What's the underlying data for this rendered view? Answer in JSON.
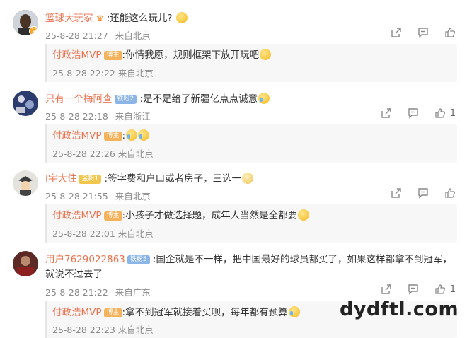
{
  "colors": {
    "username": "#eb7350",
    "meta": "#8a8a8a",
    "reply_bg": "#f7f7f7",
    "blogger_badge": "#f3b25c"
  },
  "comments": [
    {
      "user": "篮球大玩家",
      "text": ":还能这么玩儿?",
      "emoji": "surprised-emoji",
      "date": "25-8-28 21:27",
      "location": "来自北京",
      "like_count": "",
      "reply": {
        "user": "付政浩MVP",
        "badge": "博主",
        "text": ":你情我愿，规则框架下放开玩吧",
        "emoji": "laugh-emoji",
        "date": "25-8-28 22:22",
        "location": "来自北京"
      }
    },
    {
      "user": "只有一个梅阿查",
      "badge": "铁粉2",
      "text": ":是不是给了新疆亿点点诚意",
      "emoji": "laugh-cry-emoji",
      "date": "25-8-28 22:18",
      "location": "来自浙江",
      "like_count": "1",
      "reply": {
        "user": "付政浩MVP",
        "badge": "博主",
        "text": ":",
        "emoji": "laugh-cry-emoji",
        "date": "25-8-28 22:26",
        "location": "来自北京"
      }
    },
    {
      "user": "I宇大住",
      "badge": "金粉1",
      "text": ":签字费和户口或者房子，三选一",
      "emoji": "cat-emoji",
      "date": "25-8-28 21:55",
      "location": "来自北京",
      "like_count": "",
      "reply": {
        "user": "付政浩MVP",
        "badge": "博主",
        "text": ":小孩子才做选择题，成年人当然是全都要",
        "emoji": "laugh-emoji",
        "date": "25-8-28 22:01",
        "location": "来自北京"
      }
    },
    {
      "user": "用户7629022863",
      "badge": "铁粉5",
      "text": ":国企就是不一样，把中国最好的球员都买了，如果这样都拿不到冠军，",
      "text2": "就说不过去了",
      "date": "25-8-28 21:22",
      "location": "来自广东",
      "like_count": "1",
      "reply": {
        "user": "付政浩MVP",
        "badge": "博主",
        "text": ":拿不到冠军就接着买呗，每年都有预算",
        "emoji": "cry-emoji",
        "date": "25-8-28 22:23",
        "location": "来自北京"
      }
    }
  ],
  "watermark": "dydftl.com"
}
